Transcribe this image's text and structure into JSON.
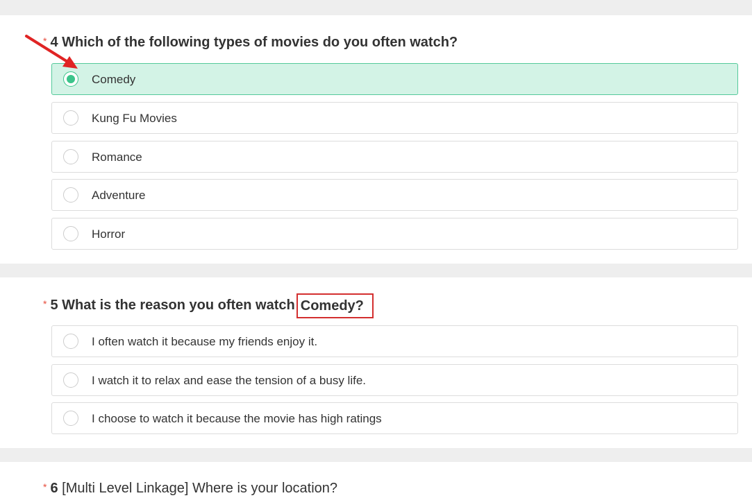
{
  "questions": [
    {
      "number": "4",
      "required_mark": "*",
      "title": "Which of the following types of movies do you often watch?",
      "options": [
        "Comedy",
        "Kung Fu Movies",
        "Romance",
        "Adventure",
        "Horror"
      ],
      "selected": "Comedy"
    },
    {
      "number": "5",
      "required_mark": "*",
      "title_prefix": "What is the reason you often watch",
      "title_highlight": "Comedy?",
      "options": [
        "I often watch it because my friends enjoy it.",
        "I watch it to relax and ease the tension of a busy life.",
        "I choose to watch it because the movie has high ratings"
      ]
    },
    {
      "number": "6",
      "required_mark": "*",
      "title": "[Multi Level Linkage] Where is your location?"
    }
  ],
  "annotations": {
    "arrow_color": "#e02424",
    "highlight_box_color": "#d32f2f"
  },
  "colors": {
    "selected_bg": "#d3f3e6",
    "selected_border": "#54c99a",
    "radio_dot": "#3cc48b",
    "required_star": "#e74c3c",
    "section_gap": "#eeeeee"
  }
}
